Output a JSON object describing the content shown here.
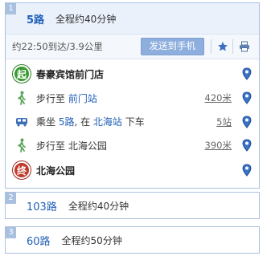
{
  "routes": [
    {
      "index": "1",
      "name": "5路",
      "total": "全程约40分钟",
      "summary": "约22:50到达/3.9公里",
      "send_label": "发送到手机",
      "steps": [
        {
          "icon": "start-icon",
          "badge": "起",
          "text": "春豪宾馆前门店"
        },
        {
          "icon": "walk-icon",
          "pre": "步行至 ",
          "link": "前门站",
          "post": "",
          "meta": "420米"
        },
        {
          "icon": "bus-icon",
          "pre": "乘坐 ",
          "link": "5路",
          "mid": ", 在 ",
          "link2": "北海站",
          "post": " 下车",
          "meta": "5站"
        },
        {
          "icon": "walk-icon",
          "pre": "步行至 北海公园",
          "meta": "390米"
        },
        {
          "icon": "end-icon",
          "badge": "终",
          "text": "北海公园"
        }
      ]
    },
    {
      "index": "2",
      "name": "103路",
      "total": "全程约40分钟"
    },
    {
      "index": "3",
      "name": "60路",
      "total": "全程约50分钟"
    }
  ],
  "colors": {
    "accent": "#1f5fb8",
    "border": "#a9c0de",
    "start": "#3a9a2f",
    "end": "#c0392b"
  }
}
